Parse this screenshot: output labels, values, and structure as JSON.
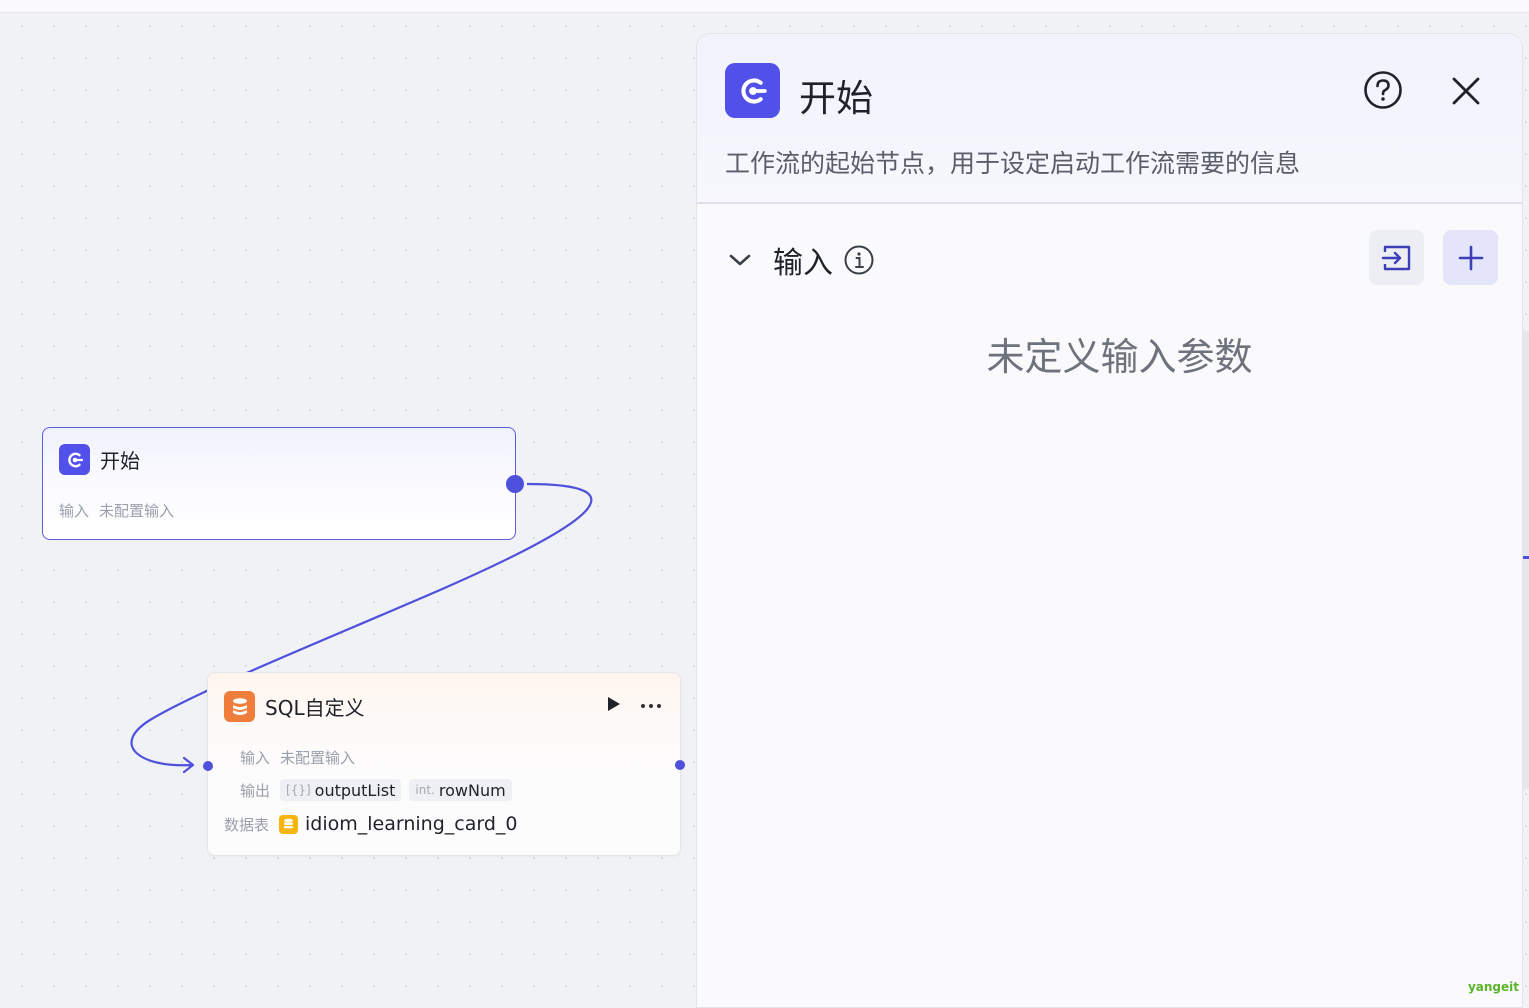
{
  "canvas": {
    "start_node": {
      "title": "开始",
      "input_label": "输入",
      "input_value": "未配置输入",
      "icon": "workflow-start-icon"
    },
    "sql_node": {
      "title": "SQL自定义",
      "icon": "database-icon",
      "input_label": "输入",
      "input_value": "未配置输入",
      "output_label": "输出",
      "outputs": [
        {
          "type": "[{}]",
          "name": "outputList"
        },
        {
          "type": "int.",
          "name": "rowNum"
        }
      ],
      "table_label": "数据表",
      "table_name": "idiom_learning_card_0",
      "actions": [
        "run-icon",
        "more-icon"
      ]
    }
  },
  "panel": {
    "title": "开始",
    "description": "工作流的起始节点，用于设定启动工作流需要的信息",
    "section": {
      "title": "输入",
      "empty_text": "未定义输入参数"
    },
    "icons": [
      "help-icon",
      "close-icon",
      "chevron-down-icon",
      "info-icon",
      "import-icon",
      "plus-icon"
    ]
  },
  "watermark": "yangeit",
  "colors": {
    "accent": "#5150e8",
    "sql_orange": "#f07d3a",
    "db_yellow": "#f6b50c",
    "edge": "#4f50dc"
  }
}
